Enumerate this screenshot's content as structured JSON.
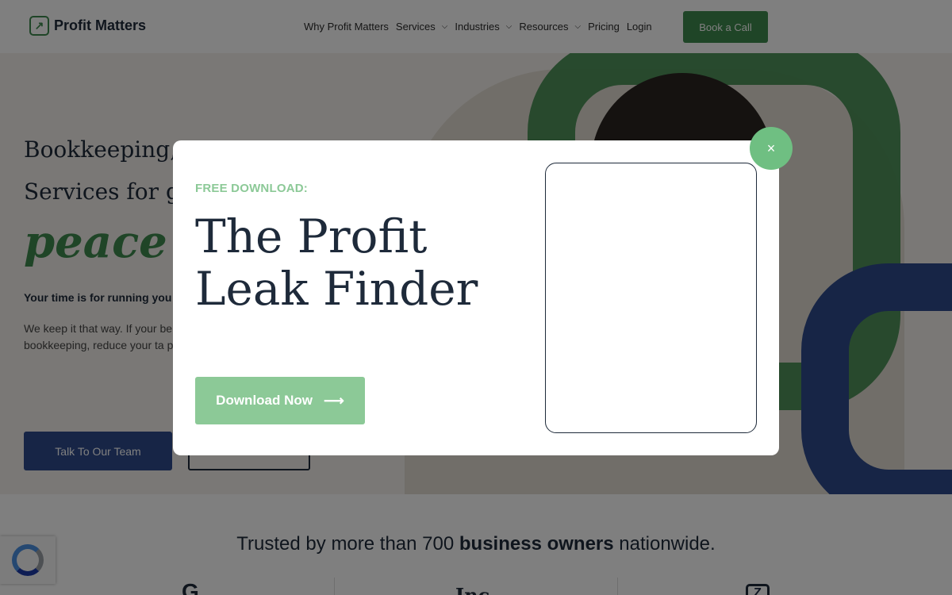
{
  "header": {
    "logo_text": "Profit Matters",
    "logo_icon": "arrow-up-right-icon",
    "nav": [
      {
        "label": "Why Profit Matters",
        "has_dropdown": false
      },
      {
        "label": "Services",
        "has_dropdown": true
      },
      {
        "label": "Industries",
        "has_dropdown": true
      },
      {
        "label": "Resources",
        "has_dropdown": true
      },
      {
        "label": "Pricing",
        "has_dropdown": false
      },
      {
        "label": "Login",
        "has_dropdown": false
      }
    ],
    "cta_label": "Book a Call"
  },
  "hero": {
    "line1": "Bookkeeping, T",
    "line2": "Services for gr",
    "script": "peace o",
    "subheading": "Your time is for running you",
    "body": "We keep it that way. If your be either - and that mistake bookkeeping, reduce your ta peace of mind. Finally, a ser again.",
    "talk_label": "Talk To Our Team"
  },
  "trusted": {
    "prefix": "Trusted by more than 700 ",
    "bold": "business owners",
    "suffix": " nationwide.",
    "logos": [
      "G",
      "Inc",
      "Z"
    ]
  },
  "modal": {
    "eyebrow": "FREE DOWNLOAD:",
    "title": "The Profit Leak Finder",
    "download_label": "Download Now",
    "arrow_icon": "arrow-right-icon",
    "close_icon": "close-icon",
    "close_glyph": "×",
    "accent_color": "#8cc997"
  },
  "colors": {
    "brand_green": "#3f8a4e",
    "brand_blue": "#2e4a8c",
    "overlay": "rgba(0,0,0,0.5)"
  }
}
